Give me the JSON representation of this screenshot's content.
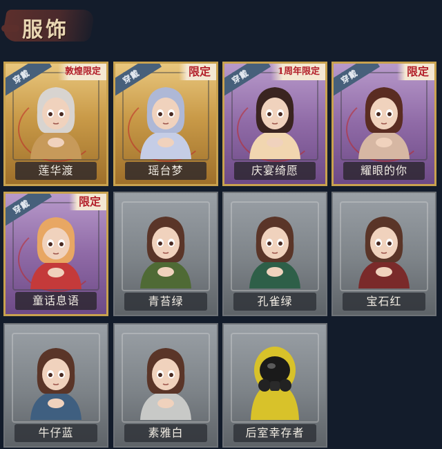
{
  "section": {
    "title": "服饰"
  },
  "badges": {
    "equipped": "穿戴",
    "limited": "限定",
    "anniversary_limited": "1周年限定",
    "dunhuang_limited": "敦煌限定"
  },
  "costumes": [
    {
      "name": "莲华渡",
      "style": "gold",
      "equipped": true,
      "tag": "敦煌限定",
      "hair": "#d8d4d0",
      "outfit": "#c79a5a"
    },
    {
      "name": "瑶台梦",
      "style": "gold",
      "equipped": true,
      "tag": "限定",
      "hair": "#aeb8d6",
      "outfit": "#c5cde6"
    },
    {
      "name": "庆宴绮愿",
      "style": "purple",
      "equipped": true,
      "tag": "1周年限定",
      "hair": "#3a2420",
      "outfit": "#f1d6b0"
    },
    {
      "name": "耀眼的你",
      "style": "purple",
      "equipped": true,
      "tag": "限定",
      "hair": "#5a2c22",
      "outfit": "#d6b7a3"
    },
    {
      "name": "童话息语",
      "style": "purple",
      "equipped": true,
      "tag": "限定",
      "hair": "#e8a763",
      "outfit": "#c43a3a"
    },
    {
      "name": "青苔绿",
      "style": "stone",
      "equipped": false,
      "tag": "",
      "hair": "#5a3528",
      "outfit": "#4f6a35"
    },
    {
      "name": "孔雀绿",
      "style": "stone",
      "equipped": false,
      "tag": "",
      "hair": "#5a3528",
      "outfit": "#2e5f48"
    },
    {
      "name": "宝石红",
      "style": "stone",
      "equipped": false,
      "tag": "",
      "hair": "#5a3528",
      "outfit": "#7a2a2a"
    },
    {
      "name": "牛仔蓝",
      "style": "stone",
      "equipped": false,
      "tag": "",
      "hair": "#5a3528",
      "outfit": "#3f5f80"
    },
    {
      "name": "素雅白",
      "style": "stone",
      "equipped": false,
      "tag": "",
      "hair": "#5a3528",
      "outfit": "#c8c9c7"
    },
    {
      "name": "后室幸存者",
      "style": "stone",
      "equipped": false,
      "tag": "",
      "hair": "#111111",
      "outfit": "#d8c22a"
    }
  ]
}
